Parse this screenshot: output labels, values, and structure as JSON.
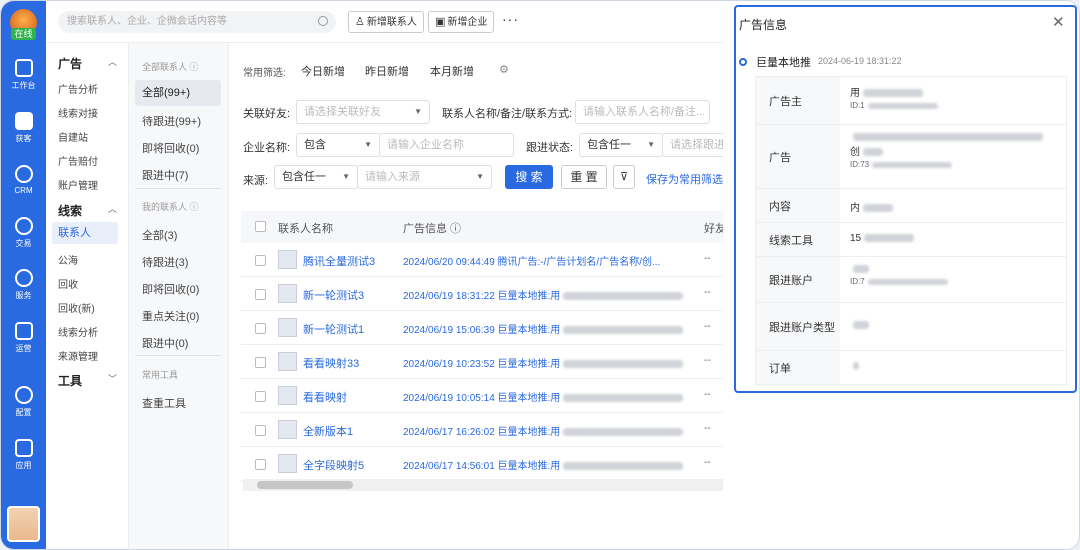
{
  "rail": {
    "status": "在线",
    "items": [
      {
        "label": "工作台",
        "icon": "workbench-icon"
      },
      {
        "label": "获客",
        "icon": "acquire-icon"
      },
      {
        "label": "CRM",
        "icon": "person-icon"
      },
      {
        "label": "交易",
        "icon": "yen-icon"
      },
      {
        "label": "服务",
        "icon": "chat-icon"
      },
      {
        "label": "运营",
        "icon": "bar-chart-icon"
      },
      {
        "label": "配置",
        "icon": "gear-icon"
      },
      {
        "label": "应用",
        "icon": "grid-icon"
      }
    ]
  },
  "topbar": {
    "search_placeholder": "搜索联系人、企业、企微会话内容等",
    "new_contact": "新增联系人",
    "new_company": "新增企业",
    "more": "···"
  },
  "nav2": {
    "sections": [
      {
        "title": "广告",
        "items": [
          "广告分析",
          "线索对接",
          "自建站",
          "广告赔付",
          "账户管理"
        ]
      },
      {
        "title": "线索",
        "items": [
          "联系人",
          "公海",
          "回收",
          "回收(新)",
          "线索分析",
          "来源管理"
        ]
      },
      {
        "title": "工具",
        "items": []
      }
    ],
    "active": "联系人"
  },
  "nav3": {
    "all_header": "全部联系人 ⓘ",
    "all_items": [
      "全部(99+)",
      "待跟进(99+)",
      "即将回收(0)",
      "跟进中(7)"
    ],
    "my_header": "我的联系人 ⓘ",
    "my_items": [
      "全部(3)",
      "待跟进(3)",
      "即将回收(0)",
      "重点关注(0)",
      "跟进中(0)"
    ],
    "tools_header": "常用工具",
    "tools_items": [
      "查重工具"
    ]
  },
  "filters": {
    "quick_label": "常用筛选:",
    "quick": [
      "今日新增",
      "昨日新增",
      "本月新增"
    ],
    "friend_label": "关联好友:",
    "friend_placeholder": "请选择关联好友",
    "contact_label": "联系人名称/备注/联系方式:",
    "contact_placeholder": "请输入联系人名称/备注...",
    "company_label": "企业名称:",
    "company_op": "包含",
    "company_placeholder": "请输入企业名称",
    "follow_label": "跟进状态:",
    "follow_op": "包含任一",
    "follow_placeholder": "请选择跟进",
    "source_label": "来源:",
    "source_op": "包含任一",
    "source_placeholder": "请输入来源",
    "search_btn": "搜 索",
    "reset_btn": "重 置",
    "save_link": "保存为常用筛选"
  },
  "table": {
    "headers": [
      "联系人名称",
      "广告信息 ⓘ",
      "好友"
    ],
    "rows": [
      {
        "name": "腾讯全量测试3",
        "ad": "2024/06/20 09:44:49 腾讯广告:-/广告计划名/广告名称/创...",
        "dash": "--"
      },
      {
        "name": "新一轮测试3",
        "ad": "2024/06/19 18:31:22 巨量本地推:用",
        "dash": "--"
      },
      {
        "name": "新一轮测试1",
        "ad": "2024/06/19 15:06:39 巨量本地推:用",
        "dash": "--"
      },
      {
        "name": "看看映射33",
        "ad": "2024/06/19 10:23:52 巨量本地推:用",
        "dash": "--"
      },
      {
        "name": "看看映射",
        "ad": "2024/06/19 10:05:14 巨量本地推:用",
        "dash": "--"
      },
      {
        "name": "全新版本1",
        "ad": "2024/06/17 16:26:02 巨量本地推:用",
        "dash": "--"
      },
      {
        "name": "全字段映射5",
        "ad": "2024/06/17 14:56:01 巨量本地推:用",
        "dash": "--"
      }
    ]
  },
  "panel": {
    "title": "广告信息",
    "source": "巨量本地推",
    "timestamp": "2024-06-19 18:31:22",
    "fields": [
      {
        "key": "广告主",
        "value": "用",
        "id": "ID:1"
      },
      {
        "key": "广告",
        "value": "创",
        "id": "ID:73"
      },
      {
        "key": "内容",
        "value": "内",
        "id": ""
      },
      {
        "key": "线索工具",
        "value": "15",
        "id": ""
      },
      {
        "key": "跟进账户",
        "value": "",
        "id": "ID:7"
      },
      {
        "key": "跟进账户类型",
        "value": "",
        "id": ""
      },
      {
        "key": "订单",
        "value": "",
        "id": ""
      }
    ]
  }
}
